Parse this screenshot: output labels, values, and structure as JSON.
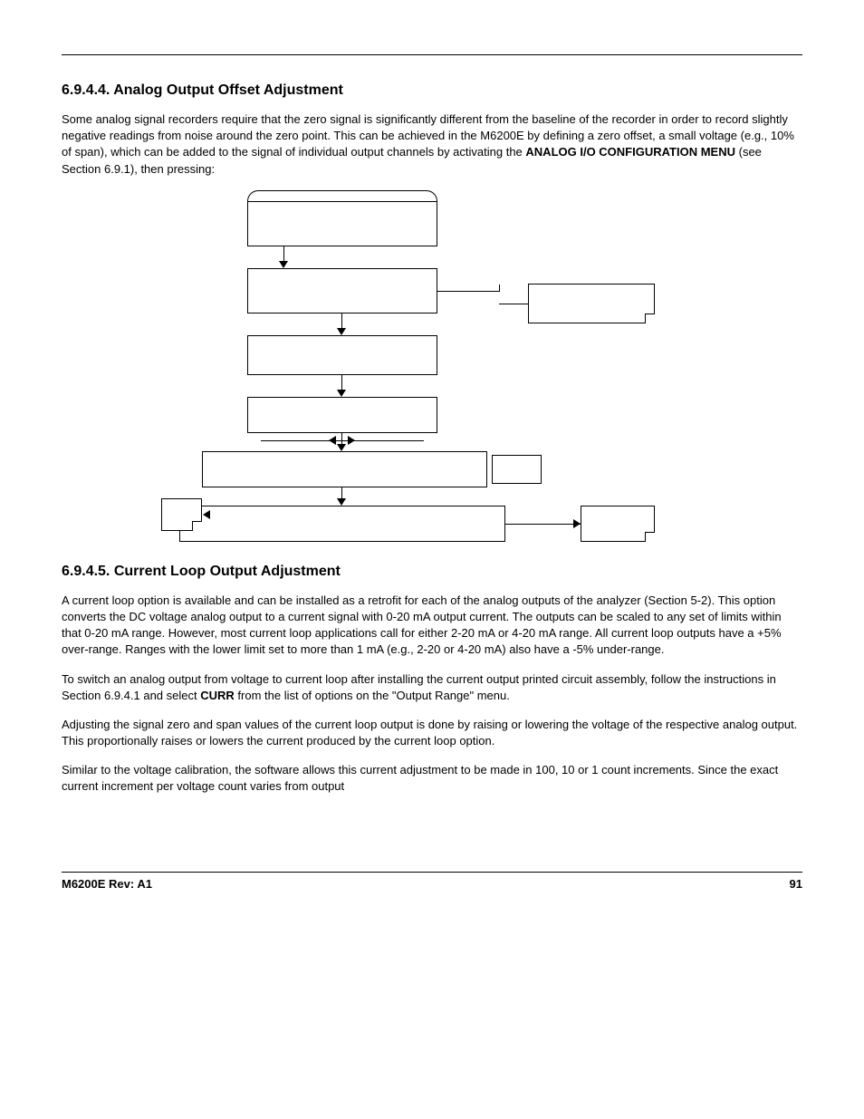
{
  "section1": {
    "heading": "6.9.4.4. Analog Output Offset Adjustment",
    "para1_a": "Some analog signal recorders require that the zero signal is significantly different from the baseline of the recorder in order to record slightly negative readings from noise around the zero point. This can be achieved in the M6200E by defining a zero offset, a small voltage (e.g., 10% of span), which can be added to the signal of individual output channels by activating the  ",
    "para1_bold1": "ANALOG I/O CONFIGURATION MENU",
    "para1_b": " (see Section 6.9.1), then pressing:"
  },
  "section2": {
    "heading": "6.9.4.5. Current Loop Output Adjustment",
    "para1": "A current loop option is available and can be installed as a retrofit for each of the analog outputs of the analyzer (Section 5-2). This option converts the DC voltage analog output to a current signal with 0-20 mA output current. The outputs can be scaled to any set of limits within that 0-20 mA range. However, most current loop applications call for either 2-20 mA or 4-20 mA range. All current loop outputs have a +5% over-range. Ranges with the lower limit set to more than 1 mA (e.g., 2-20 or 4-20 mA) also have a -5% under-range.",
    "para2_a": "To switch an analog output from voltage to current loop after installing the current output printed circuit assembly, follow the instructions in Section 6.9.4.1 and select ",
    "para2_bold": "CURR",
    "para2_b": " from the list of options on the \"Output Range\" menu.",
    "para3": "Adjusting the signal zero and span values of the current loop output is done by raising or lowering the voltage of the respective analog output. This proportionally raises or lowers the current produced by the current loop option.",
    "para4": "Similar to the voltage calibration, the software allows this current adjustment to be made in 100, 10 or 1 count increments. Since the exact current increment per voltage count varies from output"
  },
  "footer": {
    "left": "M6200E Rev: A1",
    "right": "91"
  }
}
